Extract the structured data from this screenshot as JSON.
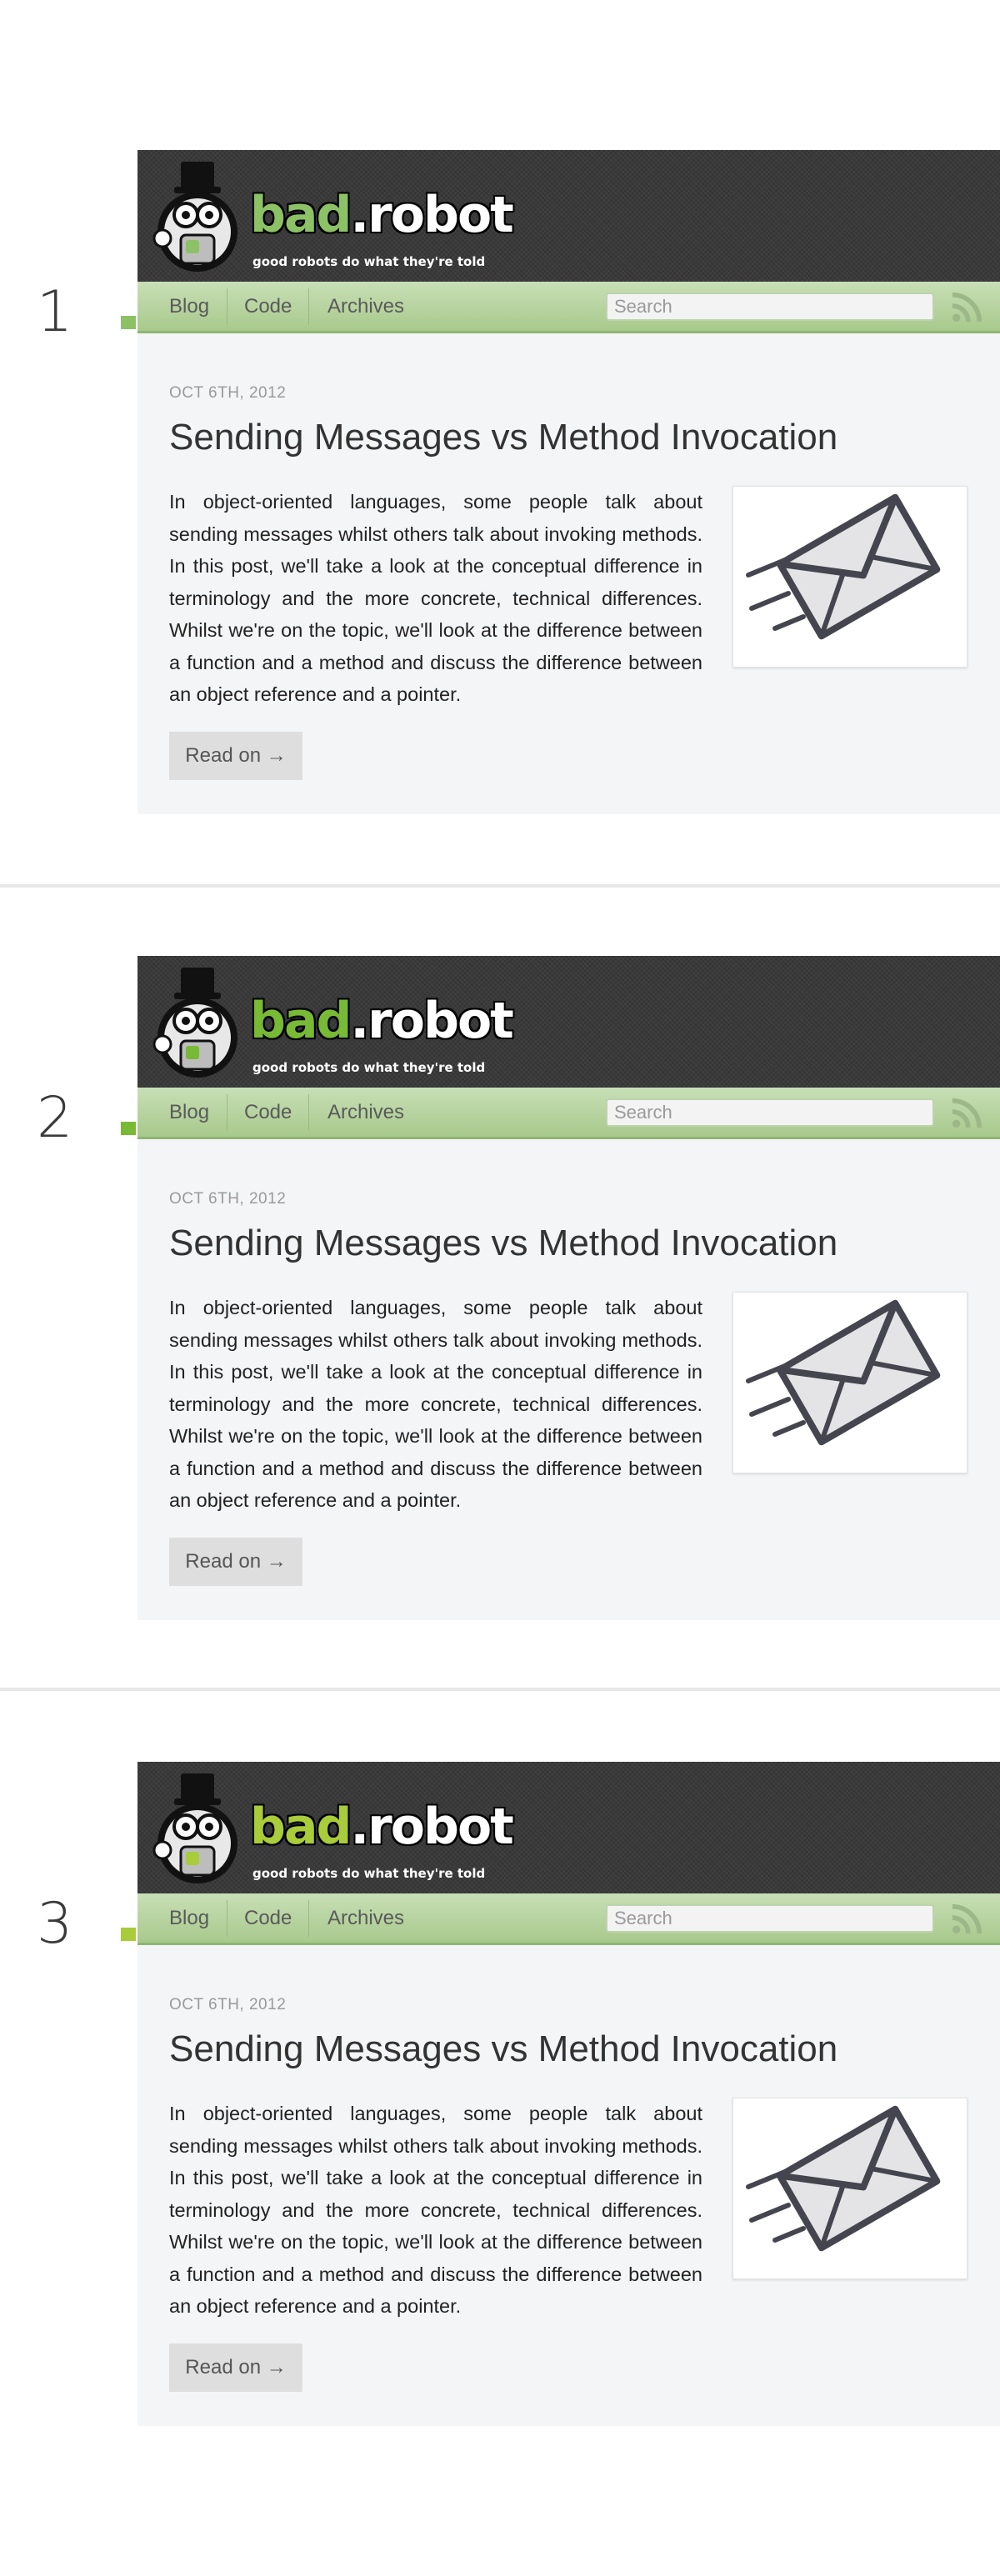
{
  "variants": [
    {
      "index": "1",
      "accent": "#8cc265",
      "logo": {
        "bad": "bad",
        "robot": ".robot",
        "tagline": "good robots do what they're told"
      },
      "nav": {
        "blog": "Blog",
        "code": "Code",
        "archives": "Archives"
      },
      "search": {
        "placeholder": "Search"
      },
      "icons": {
        "rss": "rss-icon",
        "envelope": "envelope-icon",
        "robot": "robot-mascot-logo"
      },
      "post": {
        "date": "OCT 6TH, 2012",
        "title": "Sending Messages vs Method Invocation",
        "excerpt": "In object-oriented languages, some people talk about sending messages whilst others talk about invoking methods. In this post, we'll take a look at the conceptual difference in terminology and the more concrete, technical differences. Whilst we're on the topic, we'll look at the difference between a function and a method and discuss the difference between an object reference and a pointer.",
        "read_on": "Read on →"
      }
    },
    {
      "index": "2",
      "accent": "#78b935",
      "logo": {
        "bad": "bad",
        "robot": ".robot",
        "tagline": "good robots do what they're told"
      },
      "nav": {
        "blog": "Blog",
        "code": "Code",
        "archives": "Archives"
      },
      "search": {
        "placeholder": "Search"
      },
      "icons": {
        "rss": "rss-icon",
        "envelope": "envelope-icon",
        "robot": "robot-mascot-logo"
      },
      "post": {
        "date": "OCT 6TH, 2012",
        "title": "Sending Messages vs Method Invocation",
        "excerpt": "In object-oriented languages, some people talk about sending messages whilst others talk about invoking methods. In this post, we'll take a look at the conceptual difference in terminology and the more concrete, technical differences. Whilst we're on the topic, we'll look at the difference between a function and a method and discuss the difference between an object reference and a pointer.",
        "read_on": "Read on →"
      }
    },
    {
      "index": "3",
      "accent": "#a8cc3a",
      "logo": {
        "bad": "bad",
        "robot": ".robot",
        "tagline": "good robots do what they're told"
      },
      "nav": {
        "blog": "Blog",
        "code": "Code",
        "archives": "Archives"
      },
      "search": {
        "placeholder": "Search"
      },
      "icons": {
        "rss": "rss-icon",
        "envelope": "envelope-icon",
        "robot": "robot-mascot-logo"
      },
      "post": {
        "date": "OCT 6TH, 2012",
        "title": "Sending Messages vs Method Invocation",
        "excerpt": "In object-oriented languages, some people talk about sending messages whilst others talk about invoking methods. In this post, we'll take a look at the conceptual difference in terminology and the more concrete, technical differences. Whilst we're on the topic, we'll look at the difference between a function and a method and discuss the difference between an object reference and a pointer.",
        "read_on": "Read on →"
      }
    }
  ]
}
